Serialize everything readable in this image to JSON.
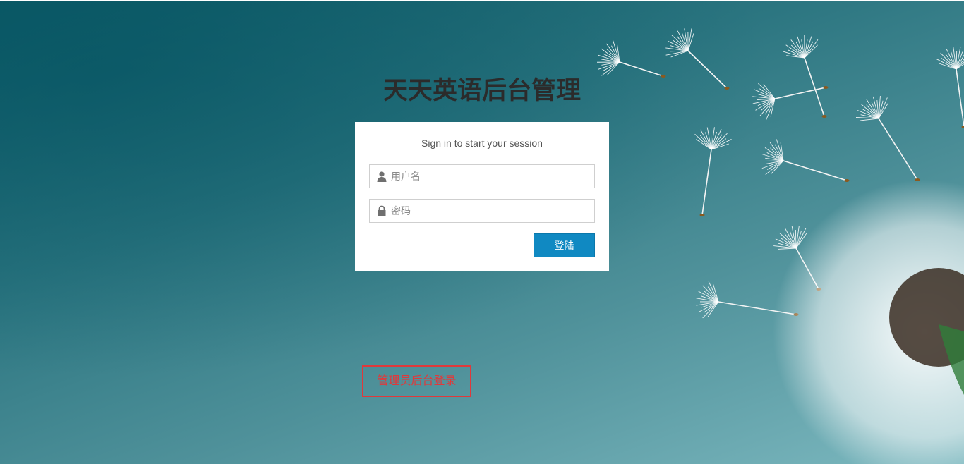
{
  "header": {
    "title": "天天英语后台管理"
  },
  "login": {
    "message": "Sign in to start your session",
    "username_placeholder": "用户名",
    "password_placeholder": "密码",
    "submit_label": "登陆",
    "username_icon": "user-icon",
    "password_icon": "lock-icon"
  },
  "footer": {
    "admin_link_label": "管理员后台登录"
  },
  "colors": {
    "accent": "#1089c2",
    "link_red": "#e0393b",
    "background": "#2b7580"
  }
}
